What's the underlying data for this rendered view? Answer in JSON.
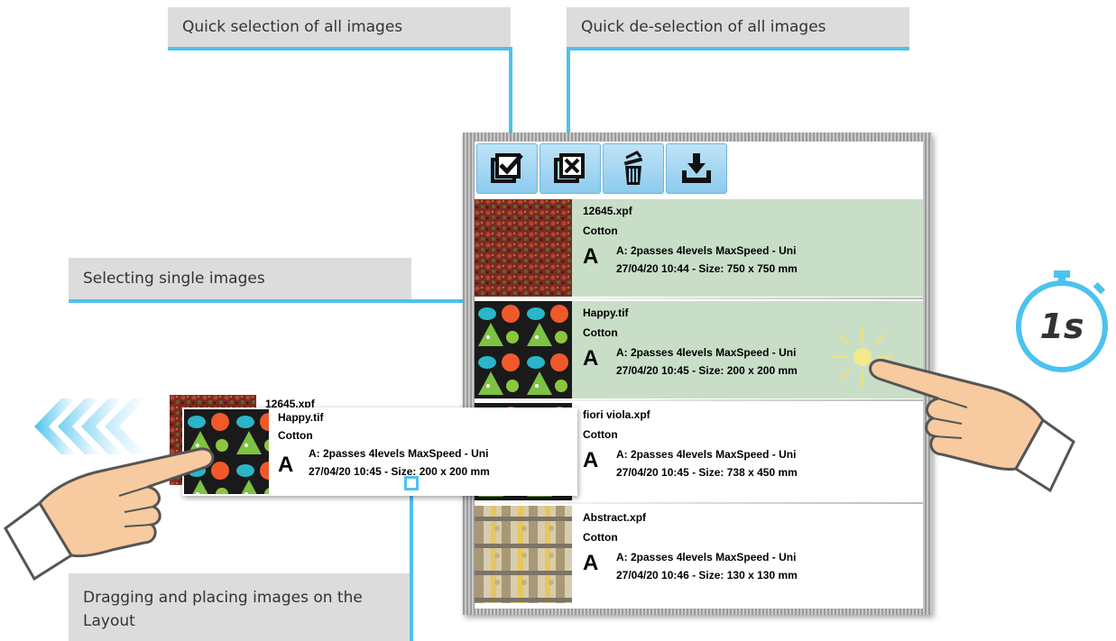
{
  "callouts": {
    "select_all": "Quick selection of all images",
    "deselect_all": "Quick de-selection of all images",
    "select_single": "Selecting single images",
    "drag_place": "Dragging and placing images on the Layout"
  },
  "timer": {
    "label": "1s"
  },
  "toolbar": {
    "buttons": [
      {
        "icon": "select-all-icon"
      },
      {
        "icon": "deselect-all-icon"
      },
      {
        "icon": "trash-icon"
      },
      {
        "icon": "import-icon"
      }
    ]
  },
  "images": [
    {
      "name": "12645.xpf",
      "material": "Cotton",
      "letter": "A",
      "mode": "A: 2passes 4levels MaxSpeed - Uni",
      "info": "27/04/20 10:44 - Size: 750 x 750 mm",
      "selected": true
    },
    {
      "name": "Happy.tif",
      "material": "Cotton",
      "letter": "A",
      "mode": "A: 2passes 4levels MaxSpeed - Uni",
      "info": "27/04/20 10:45 - Size: 200 x 200 mm",
      "selected": true
    },
    {
      "name": "fiori viola.xpf",
      "material": "Cotton",
      "letter": "A",
      "mode": "A: 2passes 4levels MaxSpeed - Uni",
      "info": "27/04/20 10:45 - Size: 738 x 450 mm",
      "selected": false
    },
    {
      "name": "Abstract.xpf",
      "material": "Cotton",
      "letter": "A",
      "mode": "A: 2passes 4levels MaxSpeed - Uni",
      "info": "27/04/20 10:46 - Size: 130 x 130 mm",
      "selected": false
    }
  ],
  "drag": {
    "back_name": "12645.xpf",
    "name": "Happy.tif",
    "material": "Cotton",
    "letter": "A",
    "mode": "A: 2passes 4levels MaxSpeed - Uni",
    "info": "27/04/20 10:45 - Size: 200 x 200 mm"
  },
  "colors": {
    "accent": "#4cc2ee",
    "selected_row": "#c9dec7",
    "callout_bg": "#dcdcdc"
  }
}
